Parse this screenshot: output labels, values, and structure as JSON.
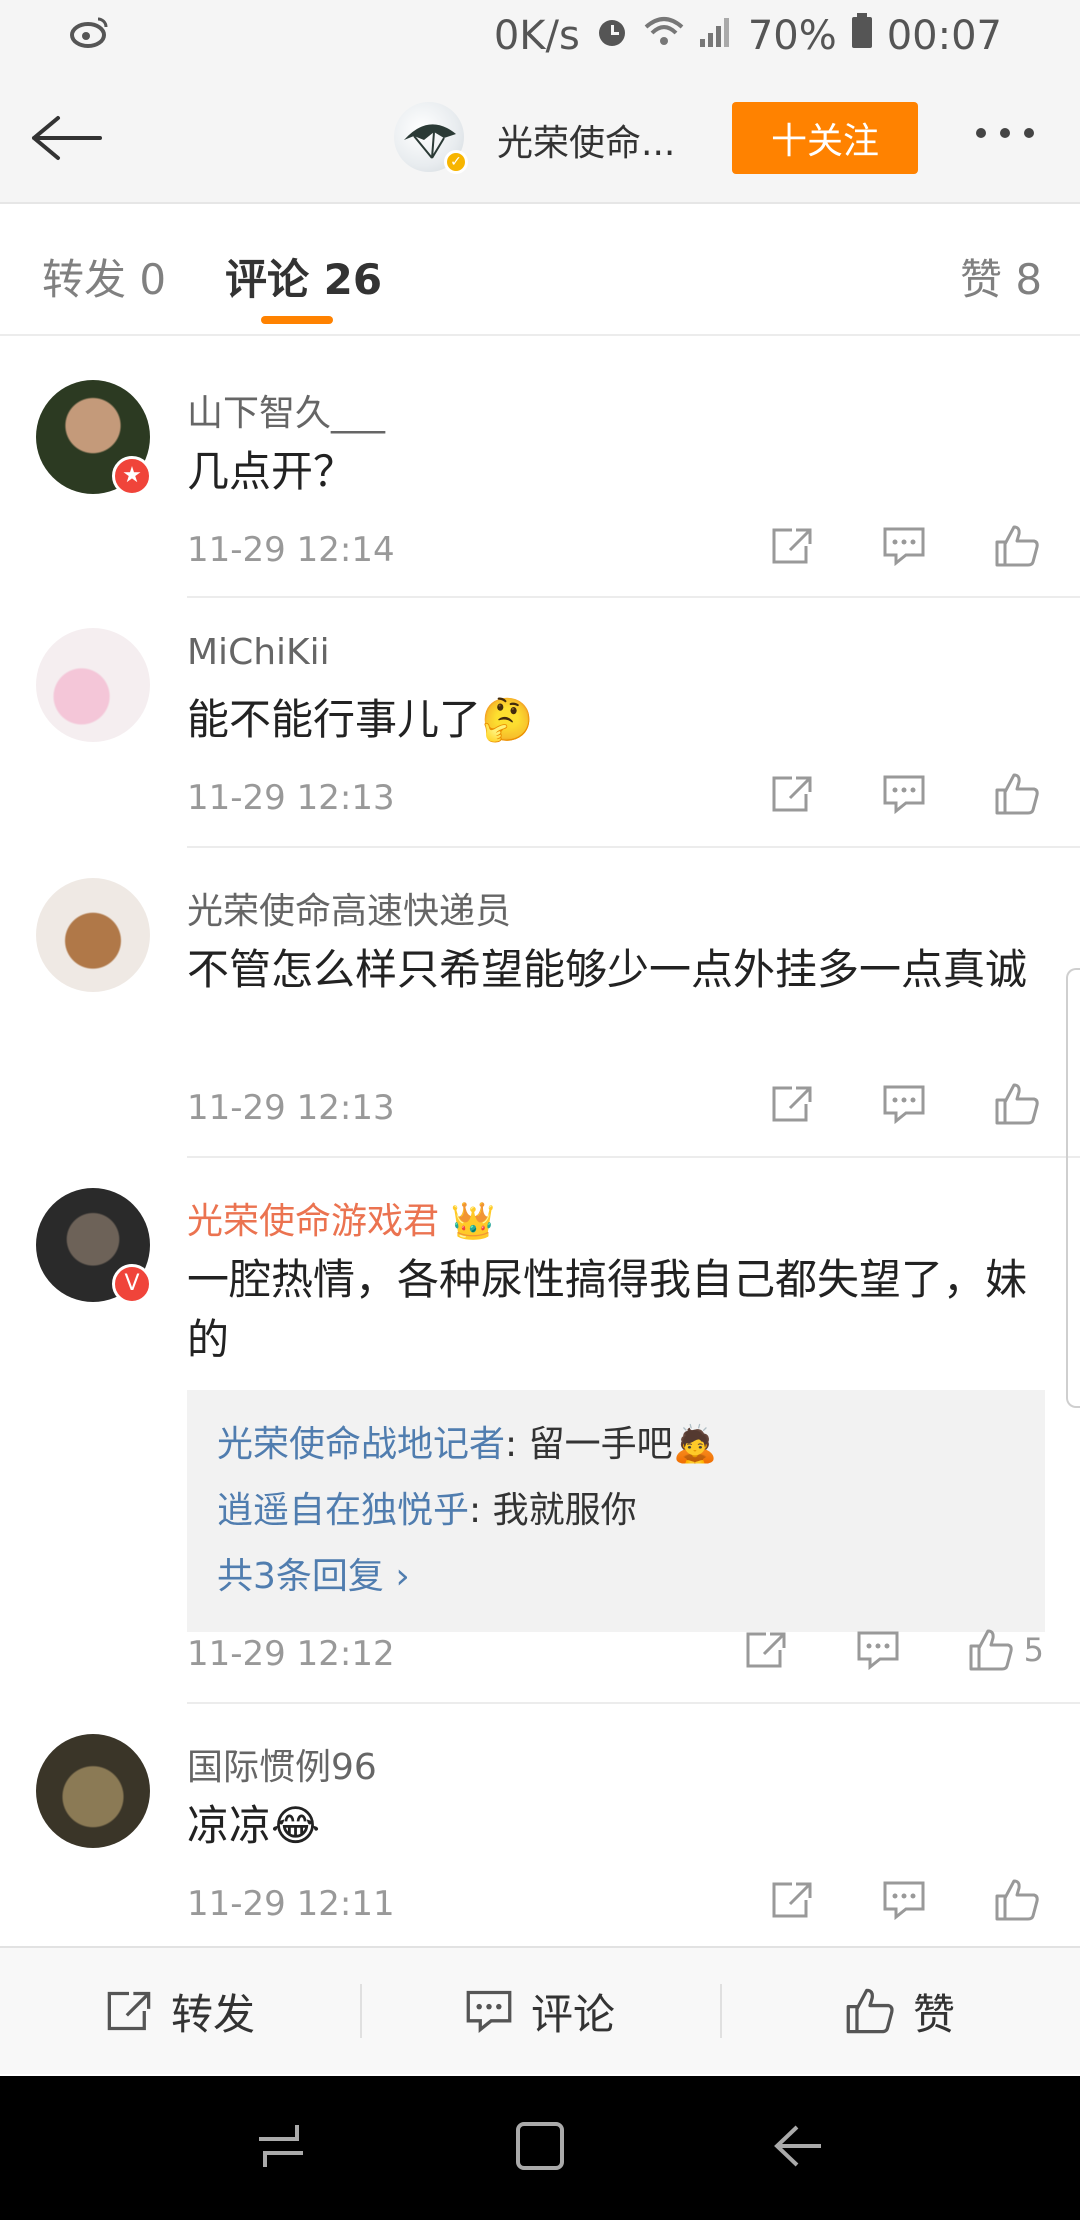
{
  "status_bar": {
    "net_speed": "0K/s",
    "battery": "70%",
    "time": "00:07"
  },
  "nav": {
    "title": "光荣使命...",
    "follow_label": "十关注"
  },
  "tabs": [
    {
      "label": "转发 0"
    },
    {
      "label": "评论 26"
    },
    {
      "label": "赞 8"
    }
  ],
  "comments": [
    {
      "name": "山下智久___",
      "text": "几点开？",
      "time": "11-29 12:14",
      "likes": ""
    },
    {
      "name": "MiChiKii",
      "text": "能不能行事儿了🤔",
      "time": "11-29 12:13",
      "likes": ""
    },
    {
      "name": "光荣使命高速快递员",
      "text": "不管怎么样只希望能够少一点外挂多一点真诚",
      "time": "11-29 12:13",
      "likes": ""
    },
    {
      "name": "光荣使命游戏君",
      "text": "一腔热情，各种尿性搞得我自己都失望了，妹的",
      "time": "11-29 12:12",
      "likes": "5",
      "replies": [
        {
          "name": "光荣使命战地记者",
          "text": ": 留一手吧🙇"
        },
        {
          "name": "逍遥自在独悦乎",
          "text": ": 我就服你"
        }
      ],
      "more_replies": "共3条回复 ›"
    },
    {
      "name": "国际惯例96",
      "text": "凉凉😂",
      "time": "11-29 12:11",
      "likes": ""
    }
  ],
  "bottom_bar": {
    "repost": "转发",
    "comment": "评论",
    "like": "赞"
  },
  "colors": {
    "accent": "#ff8200",
    "link": "#507daf",
    "vip_name": "#eb7350"
  }
}
